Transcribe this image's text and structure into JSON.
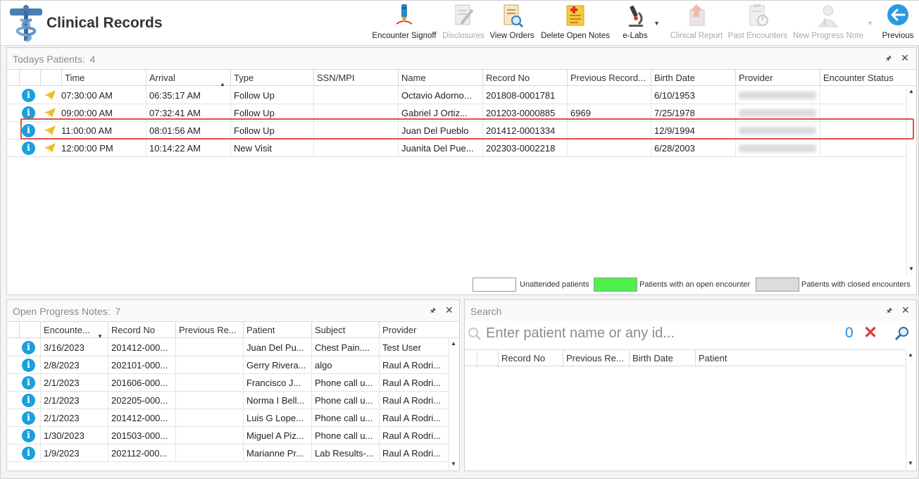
{
  "app": {
    "title": "Clinical Records"
  },
  "toolbar": [
    {
      "name": "encounter-signoff-button",
      "label": "Encounter Signoff",
      "icon": "signature-pen-icon",
      "disabled": false
    },
    {
      "name": "disclosures-button",
      "label": "Disclosures",
      "icon": "document-pencil-icon",
      "disabled": true
    },
    {
      "name": "view-orders-button",
      "label": "View Orders",
      "icon": "document-magnifier-icon",
      "disabled": false
    },
    {
      "name": "delete-open-notes-button",
      "label": "Delete Open Notes",
      "icon": "notes-plus-icon",
      "disabled": false
    },
    {
      "name": "e-labs-button",
      "label": "e-Labs",
      "icon": "microscope-icon",
      "disabled": false,
      "dropdown": true
    },
    {
      "name": "clinical-report-button",
      "label": "Clinical Report",
      "icon": "report-arrow-icon",
      "disabled": true
    },
    {
      "name": "past-encounters-button",
      "label": "Past Encounters",
      "icon": "clipboard-clock-icon",
      "disabled": true
    },
    {
      "name": "new-progress-note-button",
      "label": "New Progress Note",
      "icon": "doctor-icon",
      "disabled": true,
      "dropdown": true
    },
    {
      "name": "previous-button",
      "label": "Previous",
      "icon": "arrow-left-circle-icon",
      "disabled": false
    }
  ],
  "todays_patients": {
    "title": "Todays Patients:",
    "count": "4",
    "columns": [
      "Time",
      "Arrival",
      "Type",
      "SSN/MPI",
      "Name",
      "Record No",
      "Previous Record...",
      "Birth Date",
      "Provider",
      "Encounter Status"
    ],
    "rows": [
      {
        "time": "07:30:00 AM",
        "arrival": "06:35:17 AM",
        "type": "Follow Up",
        "ssn": "",
        "name": "Octavio Adorno...",
        "record_no": "201808-0001781",
        "previous_record": "",
        "birth_date": "6/10/1953",
        "status": ""
      },
      {
        "time": "09:00:00 AM",
        "arrival": "07:32:41 AM",
        "type": "Follow Up",
        "ssn": "",
        "name": "Gabriel J Ortiz...",
        "record_no": "201203-0000885",
        "previous_record": "6969",
        "birth_date": "7/25/1978",
        "status": ""
      },
      {
        "time": "11:00:00 AM",
        "arrival": "08:01:56 AM",
        "type": "Follow Up",
        "ssn": "",
        "name": "Juan Del Pueblo",
        "record_no": "201412-0001334",
        "previous_record": "",
        "birth_date": "12/9/1994",
        "status": ""
      },
      {
        "time": "12:00:00 PM",
        "arrival": "10:14:22 AM",
        "type": "New Visit",
        "ssn": "",
        "name": "Juanita Del Pue...",
        "record_no": "202303-0002218",
        "previous_record": "",
        "birth_date": "6/28/2003",
        "status": ""
      }
    ],
    "legend": [
      {
        "label": "Unattended patients",
        "color": "#ffffff"
      },
      {
        "label": "Patients with an open encounter",
        "color": "#4df04d"
      },
      {
        "label": "Patients with closed encounters",
        "color": "#dcdcdc"
      }
    ]
  },
  "open_progress_notes": {
    "title": "Open Progress Notes:",
    "count": "7",
    "columns": [
      "Encounte...",
      "Record No",
      "Previous Re...",
      "Patient",
      "Subject",
      "Provider"
    ],
    "rows": [
      {
        "date": "3/16/2023",
        "record_no": "201412-000...",
        "previous": "",
        "patient": "Juan Del Pu...",
        "subject": "Chest Pain....",
        "provider": "Test User"
      },
      {
        "date": "2/8/2023",
        "record_no": "202101-000...",
        "previous": "",
        "patient": "Gerry Rivera...",
        "subject": "algo",
        "provider": "Raul A Rodri..."
      },
      {
        "date": "2/1/2023",
        "record_no": "201606-000...",
        "previous": "",
        "patient": "Francisco J...",
        "subject": "Phone call u...",
        "provider": "Raul A Rodri..."
      },
      {
        "date": "2/1/2023",
        "record_no": "202205-000...",
        "previous": "",
        "patient": "Norma I Bell...",
        "subject": "Phone call u...",
        "provider": "Raul A Rodri..."
      },
      {
        "date": "2/1/2023",
        "record_no": "201412-000...",
        "previous": "",
        "patient": "Luis G Lope...",
        "subject": "Phone call u...",
        "provider": "Raul A Rodri..."
      },
      {
        "date": "1/30/2023",
        "record_no": "201503-000...",
        "previous": "",
        "patient": "Miguel A Piz...",
        "subject": "Phone call u...",
        "provider": "Raul A Rodri..."
      },
      {
        "date": "1/9/2023",
        "record_no": "202112-000...",
        "previous": "",
        "patient": "Marianne Pr...",
        "subject": "Lab Results-...",
        "provider": "Raul A Rodri..."
      }
    ]
  },
  "search": {
    "title": "Search",
    "placeholder": "Enter patient name or any id...",
    "count": "0",
    "columns": [
      "Record No",
      "Previous Re...",
      "Birth Date",
      "Patient"
    ]
  },
  "colors": {
    "accent": "#1a8fe0",
    "highlight_border": "#e0504b",
    "info_icon": "#1aa0dc",
    "clear": "#e03a3a"
  }
}
